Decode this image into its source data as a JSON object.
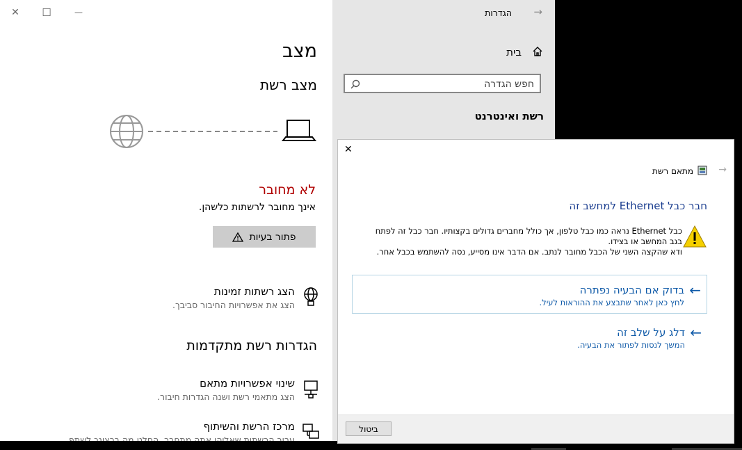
{
  "window_controls": {
    "close": "✕",
    "maximize": "☐",
    "minimize": "—"
  },
  "settings": {
    "nav": {
      "title": "הגדרות",
      "home_label": "בית",
      "search_placeholder": "חפש הגדרה",
      "section_label": "רשת ואינטרנט"
    },
    "main": {
      "title": "מצב",
      "subtitle": "מצב רשת",
      "status_heading": "לא מחובר",
      "status_text": "אינך מחובר לרשתות כלשהן.",
      "troubleshoot_label": "פתור בעיות",
      "show_networks": {
        "title": "הצג רשתות זמינות",
        "desc": "הצג את אפשרויות החיבור סביבך."
      },
      "advanced_heading": "הגדרות רשת מתקדמות",
      "change_adapter": {
        "title": "שינוי אפשרויות מתאם",
        "desc": "הצג מתאמי רשת ושנה הגדרות חיבור."
      },
      "network_center": {
        "title": "מרכז הרשת והשיתוף",
        "desc": "עבור הרשתות שאליהן אתה מתחבר, החלט מה ברצונך לשתף."
      }
    }
  },
  "dialog": {
    "breadcrumb": "מתאם רשת",
    "heading": "חבר כבל Ethernet למחשב זה",
    "warning_text": "כבל Ethernet נראה כמו כבל טלפון, אך כולל מחברים גדולים בקצותיו. חבר כבל זה לפתח בגב המחשב או בצידו.\nודא שהקצה השני של הכבל מחובר לנתב. אם הדבר אינו מסייע, נסה להשתמש בכבל אחר.",
    "check_option": {
      "title": "בדוק אם הבעיה נפתרה",
      "desc": "לחץ כאן לאחר שתבצע את ההוראות לעיל."
    },
    "skip_option": {
      "title": "דלג על שלב זה",
      "desc": "המשך לנסות לפתור את הבעיה."
    },
    "cancel_label": "ביטול"
  },
  "colors": {
    "status_red": "#b00000",
    "link_blue": "#0f5aa8",
    "heading_blue": "#1a3d8f",
    "warning_yellow": "#f5d000"
  }
}
